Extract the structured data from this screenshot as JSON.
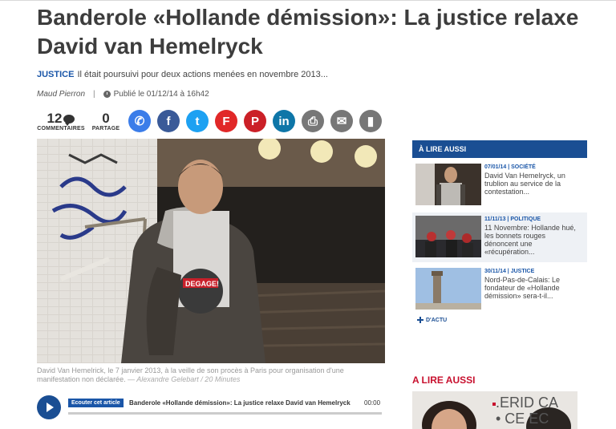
{
  "article": {
    "title": "Banderole «Hollande démission»: La justice relaxe David van Hemelryck",
    "category": "JUSTICE",
    "lead": "Il était poursuivi pour deux actions menées en novembre 2013...",
    "author": "Maud Pierron",
    "separator": "|",
    "published": "Publié le 01/12/14 à 16h42"
  },
  "counters": {
    "comments_count": "12",
    "comments_label": "COMMENTAIRES",
    "shares_count": "0",
    "shares_label": "PARTAGE"
  },
  "share_buttons": [
    {
      "name": "messenger-icon",
      "color": "#3b7de9",
      "glyph": "✆"
    },
    {
      "name": "facebook-icon",
      "color": "#3a5a98",
      "glyph": "f"
    },
    {
      "name": "twitter-icon",
      "color": "#1da1f2",
      "glyph": "t"
    },
    {
      "name": "flipboard-icon",
      "color": "#e12828",
      "glyph": "F"
    },
    {
      "name": "pinterest-icon",
      "color": "#cb2027",
      "glyph": "P"
    },
    {
      "name": "linkedin-icon",
      "color": "#0e76a8",
      "glyph": "in"
    },
    {
      "name": "print-icon",
      "color": "#777777",
      "glyph": "⎙"
    },
    {
      "name": "email-icon",
      "color": "#777777",
      "glyph": "✉"
    },
    {
      "name": "bookmark-icon",
      "color": "#777777",
      "glyph": "▮"
    }
  ],
  "photo": {
    "shirt_text": "DEGAGE!",
    "caption": "David Van Hemelrick, le 7 janvier 2013, à la veille de son procès à Paris pour organisation d'une manifestation non déclarée.",
    "credit": "— Alexandre Gelebart / 20 Minutes"
  },
  "player": {
    "listen_label": "Ecouter cet article",
    "title": "Banderole «Hollande démission»: La justice relaxe David van Hemelryck",
    "time": "00:00",
    "progress": 0.0
  },
  "sidebar": {
    "header": "À LIRE AUSSI",
    "items": [
      {
        "meta": "07/01/14 | SOCIÉTÉ",
        "text": "David Van Hemelryck, un trublion au service de la contestation..."
      },
      {
        "meta": "11/11/13 | POLITIQUE",
        "text": "11 Novembre: Hollande hué, les bonnets rouges dénoncent une «récupération..."
      },
      {
        "meta": "30/11/14 | JUSTICE",
        "text": "Nord-Pas-de-Calais: Le fondateur de «Hollande démission» sera-t-il..."
      }
    ],
    "more_link": "D'ACTU"
  },
  "related": {
    "header": "A LIRE AUSSI",
    "image_text": ".ERID CA\n• CE EC"
  },
  "colors": {
    "brand_blue": "#1a4e93",
    "link_blue": "#1a56a8",
    "accent_red": "#c8102e"
  }
}
